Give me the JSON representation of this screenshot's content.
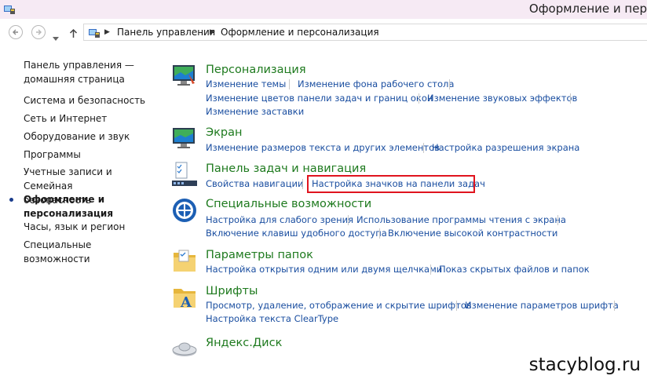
{
  "window": {
    "title": "Оформление и пер"
  },
  "address": {
    "crumbs": [
      "Панель управления",
      "Оформление и персонализация"
    ]
  },
  "sidebar": {
    "items": [
      {
        "label_line1": "Панель управления —",
        "label_line2": "домашняя страница"
      },
      {
        "label": "Система и безопасность"
      },
      {
        "label": "Сеть и Интернет"
      },
      {
        "label": "Оборудование и звук"
      },
      {
        "label": "Программы"
      },
      {
        "label_line1": "Учетные записи и Семейная",
        "label_line2": "безопасность"
      },
      {
        "label_line1": "Оформление и",
        "label_line2": "персонализация",
        "active": true
      },
      {
        "label": "Часы, язык и регион"
      },
      {
        "label": "Специальные возможности"
      }
    ]
  },
  "categories": [
    {
      "title": "Персонализация",
      "links": [
        "Изменение темы",
        "Изменение фона рабочего стола",
        "Изменение цветов панели задач и границ окон",
        "Изменение звуковых эффектов",
        "Изменение заставки"
      ]
    },
    {
      "title": "Экран",
      "links": [
        "Изменение размеров текста и других элементов",
        "Настройка разрешения экрана"
      ]
    },
    {
      "title": "Панель задач и навигация",
      "links": [
        "Свойства навигации",
        "Настройка значков на панели задач"
      ]
    },
    {
      "title": "Специальные возможности",
      "links": [
        "Настройка для слабого зрения",
        "Использование программы чтения с экрана",
        "Включение клавиш удобного доступа",
        "Включение высокой контрастности"
      ]
    },
    {
      "title": "Параметры папок",
      "links": [
        "Настройка открытия одним или двумя щелчками",
        "Показ скрытых файлов и папок"
      ]
    },
    {
      "title": "Шрифты",
      "links": [
        "Просмотр, удаление, отображение и скрытие шрифтов",
        "Изменение параметров шрифта",
        "Настройка текста ClearType"
      ]
    },
    {
      "title": "Яндекс.Диск",
      "links": []
    }
  ],
  "watermark": "stacyblog.ru",
  "colors": {
    "category_title": "#1e7a1e",
    "link": "#1a4ea0",
    "highlight": "#e0141e",
    "titlebar": "#f6eaf4"
  }
}
